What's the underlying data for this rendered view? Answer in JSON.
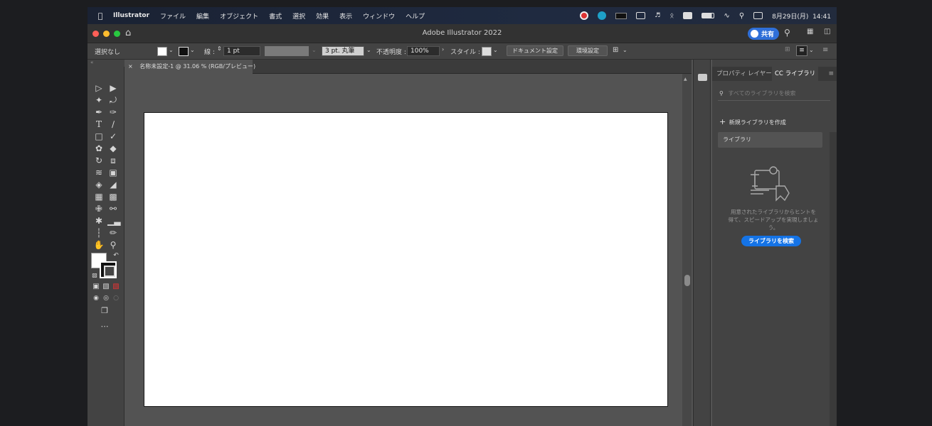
{
  "menubar": {
    "app_name": "Illustrator",
    "items": [
      "ファイル",
      "編集",
      "オブジェクト",
      "書式",
      "選択",
      "効果",
      "表示",
      "ウィンドウ",
      "ヘルプ"
    ],
    "datetime": "8月29日(月)  14:41"
  },
  "titlebar": {
    "title": "Adobe Illustrator 2022",
    "share_label": "共有"
  },
  "controlbar": {
    "selection": "選択なし",
    "stroke_label": "線 :",
    "stroke_value": "1 pt",
    "brush_value": "3 pt. 丸筆",
    "opacity_label": "不透明度 :",
    "opacity_value": "100%",
    "style_label": "スタイル :",
    "doc_settings": "ドキュメント設定",
    "preferences": "環境設定"
  },
  "document": {
    "tab_title": "名称未設定-1 @ 31.06 % (RGB/プレビュー)",
    "close_glyph": "×"
  },
  "panel": {
    "tabs": [
      "プロパティ",
      "レイヤー",
      "CC ライブラリ"
    ],
    "active_tab": "CC ライブラリ",
    "search_placeholder": "すべてのライブラリを検索",
    "new_library": "新規ライブラリを作成",
    "library_item": "ライブラリ",
    "hint_line1": "用意されたライブラリからヒントを",
    "hint_line2": "得て、スピードアップを実現しましょう。",
    "search_button": "ライブラリを検索"
  },
  "colors": {
    "accent": "#1473e6",
    "share_button": "#2f6fd8",
    "canvas": "#535353",
    "artboard": "#ffffff"
  }
}
